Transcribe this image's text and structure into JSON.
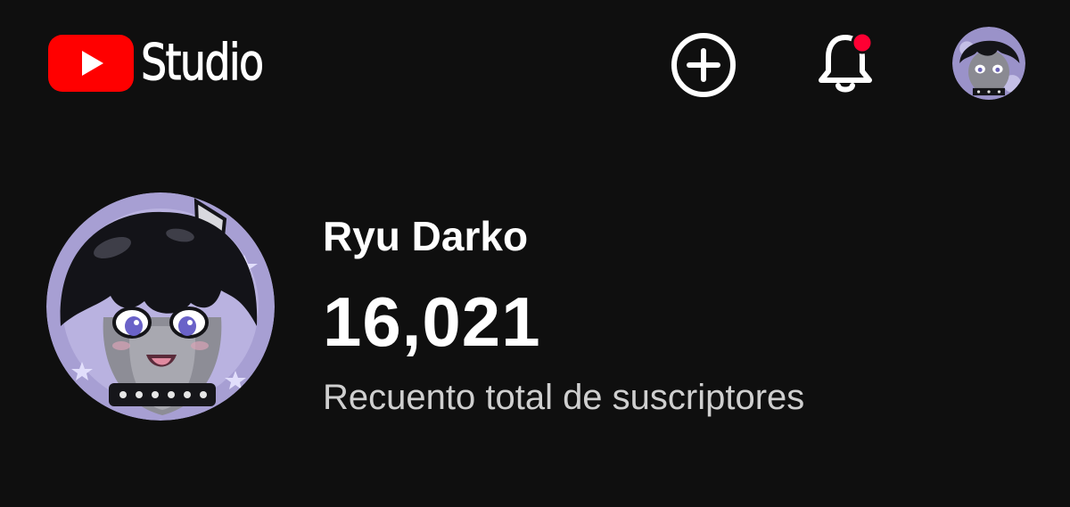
{
  "header": {
    "app_name": "Studio",
    "logo_icon": "youtube-play-icon",
    "brand_color": "#ff0000",
    "create_icon": "add-circle-icon",
    "notifications_icon": "bell-icon",
    "notifications_badge_color": "#ff0033",
    "account_icon": "avatar"
  },
  "channel": {
    "name": "Ryu Darko",
    "subscriber_count": "16,021",
    "subscriber_label": "Recuento total de suscriptores"
  }
}
